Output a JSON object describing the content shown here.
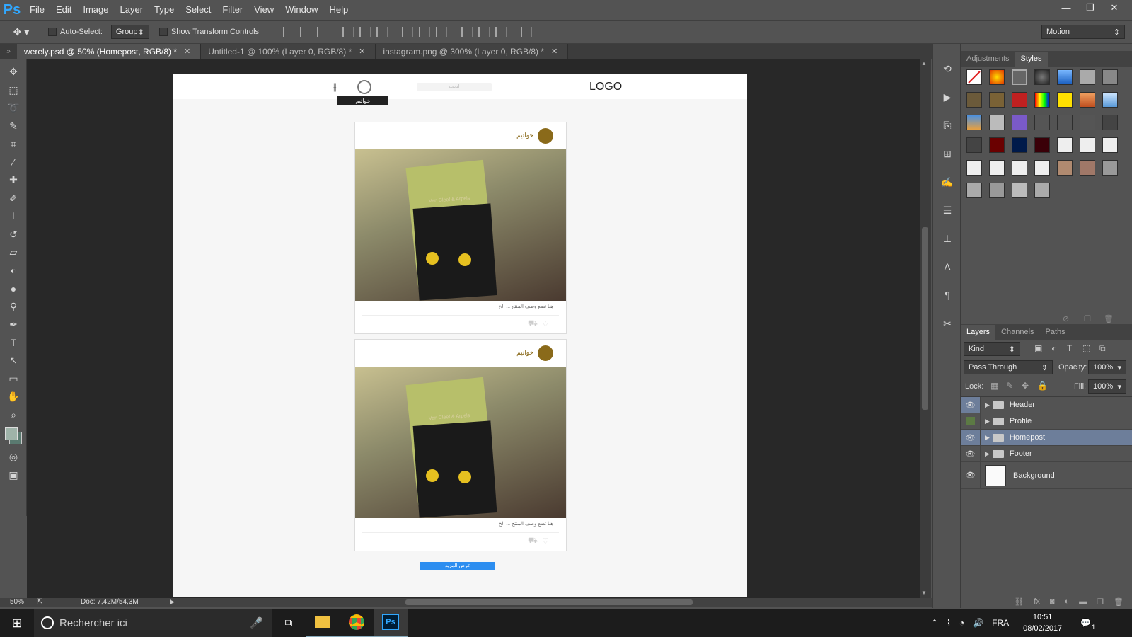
{
  "menu": {
    "logo": "Ps",
    "items": [
      "File",
      "Edit",
      "Image",
      "Layer",
      "Type",
      "Select",
      "Filter",
      "View",
      "Window",
      "Help"
    ],
    "window_controls": {
      "minimize": "—",
      "restore": "❐",
      "close": "✕"
    }
  },
  "options": {
    "auto_select_label": "Auto-Select:",
    "auto_select_value": "Group",
    "transform_label": "Show Transform Controls",
    "workspace": "Motion"
  },
  "tabs": [
    {
      "label": "werely.psd @ 50% (Homepost, RGB/8) *",
      "close": "✕"
    },
    {
      "label": "Untitled-1 @ 100% (Layer 0, RGB/8) *",
      "close": "✕"
    },
    {
      "label": "instagram.png @ 300% (Layer 0, RGB/8) *",
      "close": "✕"
    }
  ],
  "doc": {
    "logo": "LOGO",
    "search_placeholder": "ابحث",
    "tooltip": "خواتيم",
    "cards": [
      {
        "username": "خواتيم",
        "caption": "هنا تضع وصف المنتج ... الخ",
        "box_text": "Van Cleef & Arpels"
      },
      {
        "username": "خواتيم",
        "caption": "هنا تضع وصف المنتج ... الخ",
        "box_text": "Van Cleef & Arpels"
      }
    ],
    "load_more": "عرض المزيد"
  },
  "status": {
    "zoom": "50%",
    "doc_size": "Doc: 7,42M/54,3M"
  },
  "right": {
    "top_tabs": [
      "Adjustments",
      "Styles"
    ],
    "layer_tabs": [
      "Layers",
      "Channels",
      "Paths"
    ],
    "kind": "Kind",
    "blend_mode": "Pass Through",
    "opacity_label": "Opacity:",
    "opacity_value": "100%",
    "lock_label": "Lock:",
    "fill_label": "Fill:",
    "fill_value": "100%",
    "layers": [
      "Header",
      "Profile",
      "Homepost",
      "Footer",
      "Background"
    ],
    "selected_layer": "Homepost"
  },
  "taskbar": {
    "search_placeholder": "Rechercher ici",
    "lang": "FRA",
    "time": "10:51",
    "date": "08/02/2017",
    "notif": "1"
  },
  "colors": {
    "ps_blue": "#31a8ff",
    "selected_layer": "#6d7e9a",
    "load_more": "#2d8ef0",
    "brand_gold": "#8a6a1a"
  }
}
